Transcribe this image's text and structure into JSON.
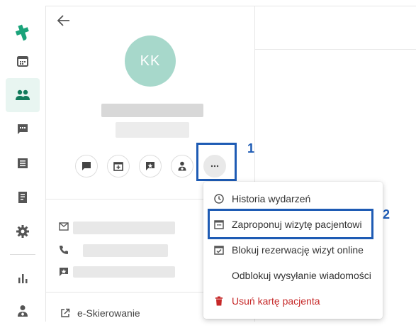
{
  "profile": {
    "initials": "KK",
    "avatar_color": "#a7d8cb"
  },
  "annotations": {
    "step1": "1",
    "step2": "2",
    "highlight_color": "#1e5bb4"
  },
  "menu": {
    "items": [
      {
        "label": "Historia wydarzeń",
        "icon": "clock-icon"
      },
      {
        "label": "Zaproponuj wizytę pacjentowi",
        "icon": "calendar-icon"
      },
      {
        "label": "Blokuj rezerwację wizyt online",
        "icon": "calendar-check-icon"
      },
      {
        "label": "Odblokuj wysyłanie wiadomości",
        "icon": ""
      },
      {
        "label": "Usuń kartę pacjenta",
        "icon": "trash-icon",
        "color": "#c62828"
      }
    ]
  },
  "links": {
    "e_skierowanie": "e-Skierowanie"
  },
  "brand": {
    "accent": "#1aa37a"
  }
}
